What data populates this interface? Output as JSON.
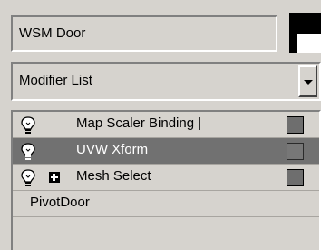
{
  "object_name": "WSM Door",
  "modifier_list": {
    "label": "Modifier List"
  },
  "stack": [
    {
      "label": "Map Scaler Binding |",
      "selected": false,
      "has_expander": false
    },
    {
      "label": "UVW Xform",
      "selected": true,
      "has_expander": false
    },
    {
      "label": "Mesh Select",
      "selected": false,
      "has_expander": true
    },
    {
      "label": "PivotDoor",
      "selected": false,
      "base_object": true
    }
  ],
  "colors": {
    "panel_bg": "#d6d3ce",
    "selected_row_bg": "#717171",
    "object_color": "#000000"
  }
}
